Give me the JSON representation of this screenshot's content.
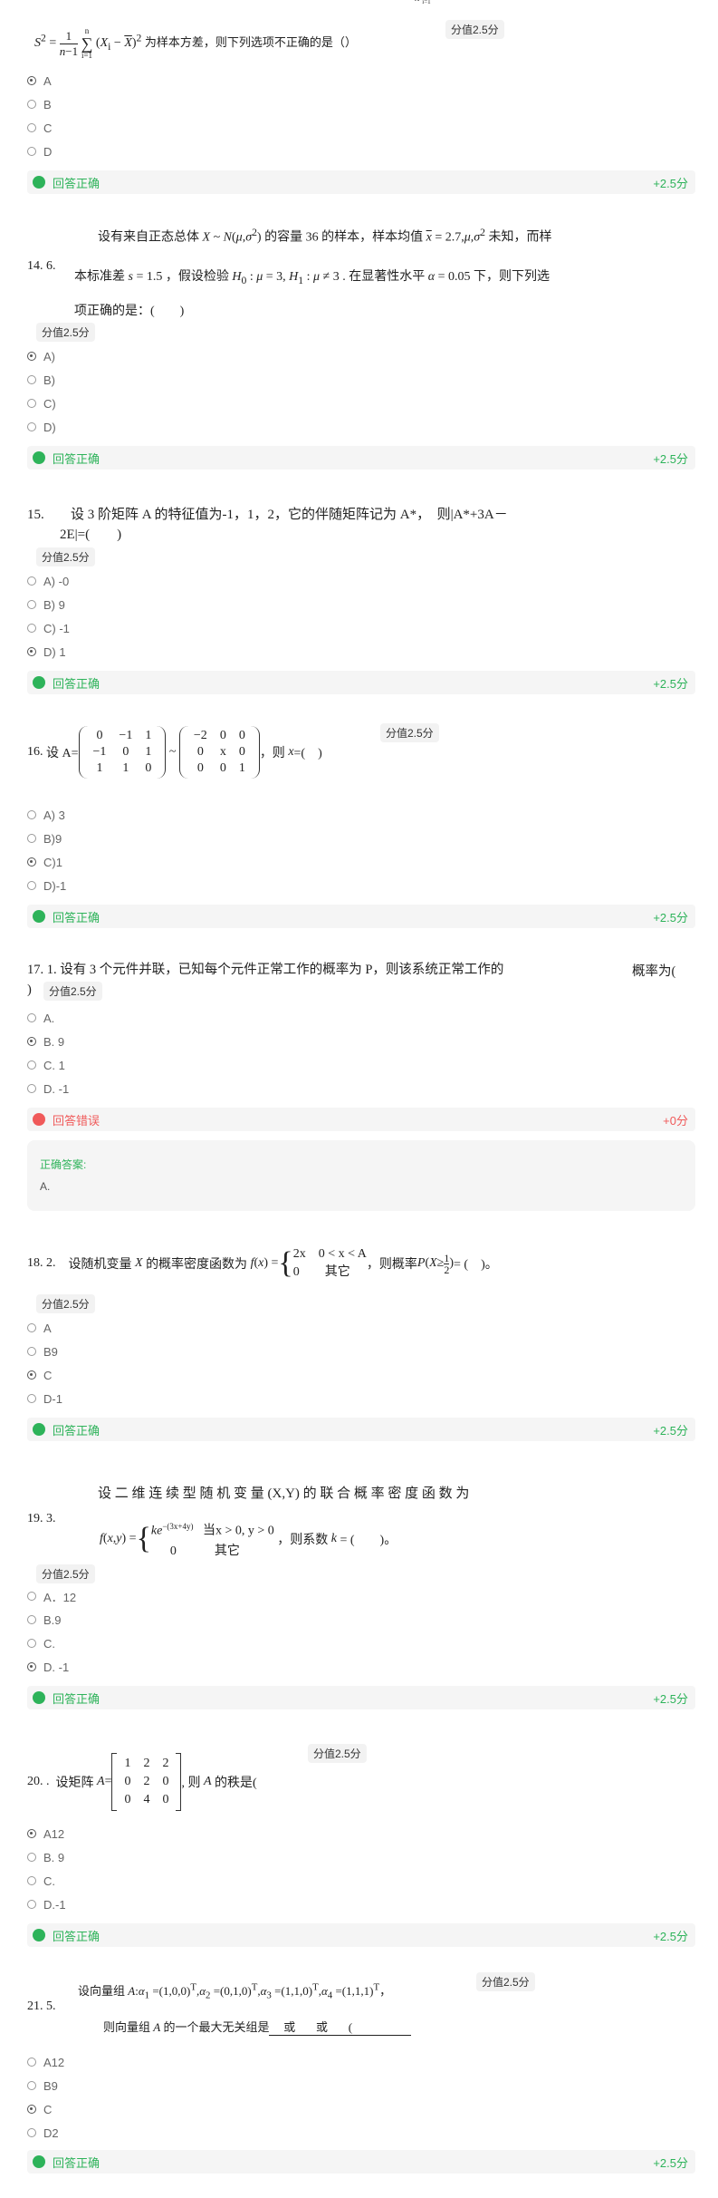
{
  "colors": {
    "correct": "#2eb35a",
    "wrong": "#f05a5a",
    "panel": "#f5f5f5"
  },
  "common": {
    "score_badge": "分值2.5分",
    "correct_label": "回答正确",
    "wrong_label": "回答错误",
    "plus_points": "+2.5分",
    "zero_points": "+0分",
    "correct_answer_title": "正确答案:"
  },
  "questions": [
    {
      "id": "q13",
      "text_tail": "为样本方差，则下列选项不正确的是（）",
      "options": [
        "A",
        "B",
        "C",
        "D"
      ],
      "selected": 0,
      "result": "correct"
    },
    {
      "id": "q14",
      "number": "14. 6.",
      "line1_a": "设有来自正态总体",
      "line1_b": "的容量 36 的样本，样本均值",
      "line1_c": "未知，而样",
      "line2_a": "本标准差",
      "line2_b": "，假设检验",
      "line2_c": ". 在显著性水平",
      "line2_d": "下，则下列选",
      "line3": "项正确的是：(　　)",
      "options": [
        "A)",
        "B)",
        "C)",
        "D)"
      ],
      "selected": 0,
      "result": "correct"
    },
    {
      "id": "q15",
      "number": "15.",
      "line1": "设 3 阶矩阵 A 的特征值为-1，1，2，它的伴随矩阵记为 A*，　则|A*+3A－",
      "line2": "2E|=(　　)",
      "options": [
        "A) -0",
        "B) 9",
        "C) -1",
        "D) 1"
      ],
      "selected": 3,
      "result": "correct"
    },
    {
      "id": "q16",
      "number": "16.",
      "prefix": "设 A=",
      "suffix": "，则",
      "tail": "=(　)",
      "matrix_left": [
        [
          "0",
          "−1",
          "1"
        ],
        [
          "−1",
          "0",
          "1"
        ],
        [
          "1",
          "1",
          "0"
        ]
      ],
      "matrix_right": [
        [
          "−2",
          "0",
          "0"
        ],
        [
          "0",
          "x",
          "0"
        ],
        [
          "0",
          "0",
          "1"
        ]
      ],
      "options": [
        "A) 3",
        "B)9",
        "C)1",
        "D)-1"
      ],
      "selected": 2,
      "result": "correct"
    },
    {
      "id": "q17",
      "line1": "17. 1.  设有 3 个元件并联，已知每个元件正常工作的概率为 P，则该系统正常工作的",
      "line1_tail": "概率为(",
      "line2": ")",
      "options": [
        "A.",
        "B. 9",
        "C. 1",
        "D. -1"
      ],
      "selected": 1,
      "result": "wrong",
      "correct_answer": "A."
    },
    {
      "id": "q18",
      "number": "18. 2.",
      "text_a": "设随机变量",
      "text_b": "的概率密度函数为",
      "case1": "2x　0 < x < A",
      "case2": "0　　其它",
      "text_c": "，则概率",
      "text_d": "= (　)。",
      "options": [
        "A",
        "B9",
        "C",
        "D-1"
      ],
      "selected": 2,
      "result": "correct"
    },
    {
      "id": "q19",
      "number": "19. 3.",
      "line1": "设 二 维 连 续 型 随 机 变 量 (X,Y) 的 联 合 概 率 密 度 函 数 为",
      "case1_r": "当x > 0, y > 0",
      "case2_l": "0",
      "case2_r": "其它",
      "tail": "，则系数",
      "tail2": "= (　　)。",
      "options": [
        "A．12",
        "B.9",
        "C.",
        "D. -1"
      ],
      "selected": 3,
      "result": "correct"
    },
    {
      "id": "q20",
      "number": "20. .",
      "prefix": "设矩阵",
      "matrix": [
        [
          "1",
          "2",
          "2"
        ],
        [
          "0",
          "2",
          "0"
        ],
        [
          "0",
          "4",
          "0"
        ]
      ],
      "suffix": "的秩是(",
      "options": [
        "A12",
        "B. 9",
        "C.",
        "D.-1"
      ],
      "selected": 0,
      "result": "correct"
    },
    {
      "id": "q21",
      "number": "21. 5.",
      "line1_a": "设向量组",
      "line2": "则向量组",
      "line2_b": "的一个最大无关组是",
      "line2_c": "或",
      "line2_d": "或",
      "line2_e": "(",
      "options": [
        "A12",
        "B9",
        "C",
        "D2"
      ],
      "selected": 2,
      "result": "correct"
    }
  ]
}
